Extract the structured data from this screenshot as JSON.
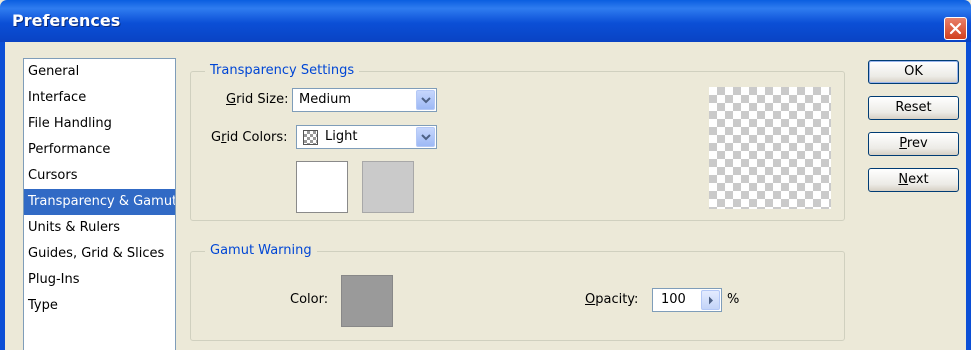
{
  "window": {
    "title": "Preferences"
  },
  "nav": {
    "items": [
      {
        "label": "General",
        "selected": false
      },
      {
        "label": "Interface",
        "selected": false
      },
      {
        "label": "File Handling",
        "selected": false
      },
      {
        "label": "Performance",
        "selected": false
      },
      {
        "label": "Cursors",
        "selected": false
      },
      {
        "label": "Transparency & Gamut",
        "selected": true
      },
      {
        "label": "Units & Rulers",
        "selected": false
      },
      {
        "label": "Guides, Grid & Slices",
        "selected": false
      },
      {
        "label": "Plug-Ins",
        "selected": false
      },
      {
        "label": "Type",
        "selected": false
      }
    ]
  },
  "transparency": {
    "legend": "Transparency Settings",
    "grid_size": {
      "label_mn": "G",
      "label_rest": "rid Size:",
      "value": "Medium"
    },
    "grid_colors": {
      "label_pre": "G",
      "label_mn": "r",
      "label_rest": "id Colors:",
      "value": "Light"
    },
    "swatch_colors": [
      "#ffffff",
      "#cacaca"
    ]
  },
  "gamut": {
    "legend": "Gamut Warning",
    "color_label": "Color:",
    "color": "#9a9a9a",
    "opacity": {
      "label_mn": "O",
      "label_rest": "pacity:",
      "value": "100",
      "unit": "%"
    }
  },
  "buttons": {
    "ok": "OK",
    "reset": "Reset",
    "prev_mn": "P",
    "prev_rest": "rev",
    "next_mn": "N",
    "next_rest": "ext"
  },
  "colors": {
    "titlebar": "#0b4fd6",
    "selection": "#316ac5",
    "legend": "#0046d5"
  }
}
